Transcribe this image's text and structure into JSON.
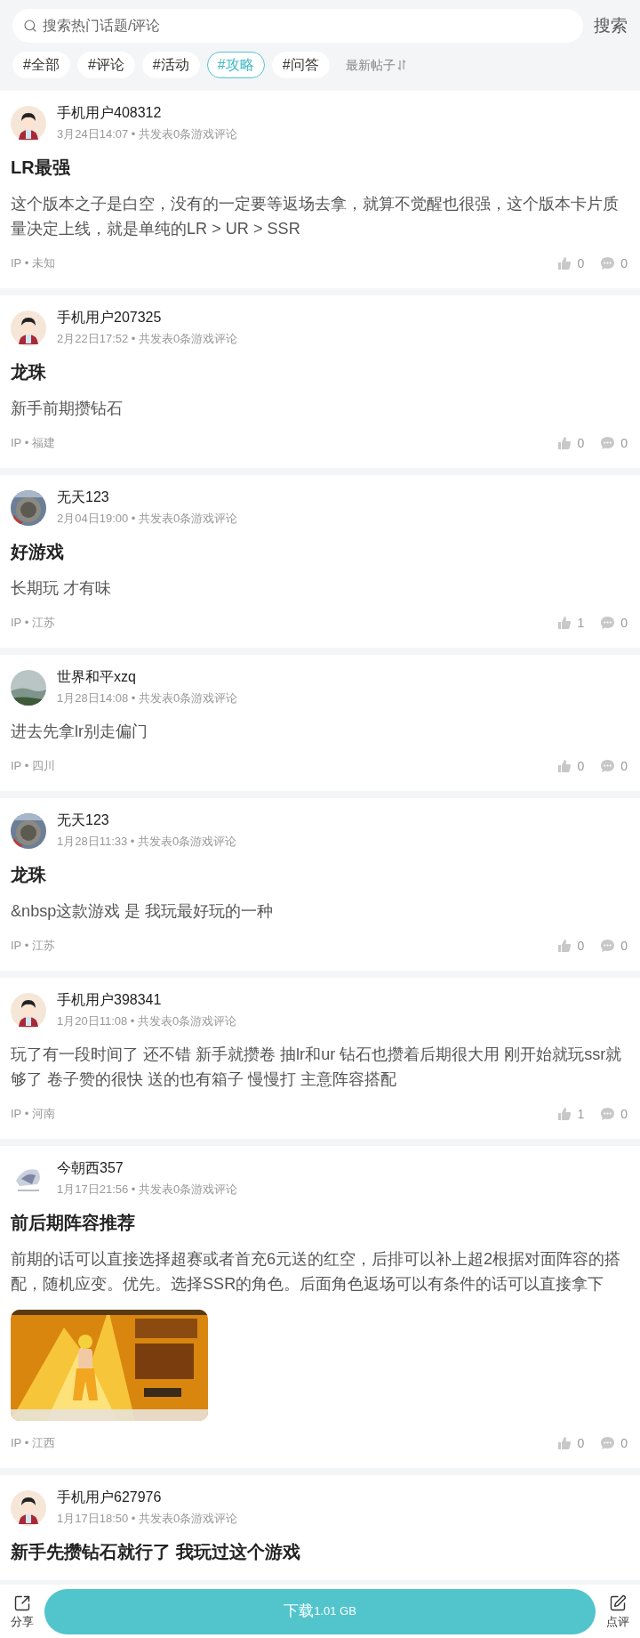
{
  "search": {
    "placeholder": "搜索热门话题/评论",
    "button": "搜索"
  },
  "tags": [
    {
      "label": "#全部",
      "selected": false
    },
    {
      "label": "#评论",
      "selected": false
    },
    {
      "label": "#活动",
      "selected": false
    },
    {
      "label": "#攻略",
      "selected": true
    },
    {
      "label": "#问答",
      "selected": false
    }
  ],
  "sort": {
    "label": "最新帖子"
  },
  "posts": [
    {
      "user": "手机用户408312",
      "avatar": {
        "kind": "cartoon"
      },
      "meta": "3月24日14:07 • 共发表0条游戏评论",
      "title": "LR最强",
      "body": "这个版本之子是白空，没有的一定要等返场去拿，就算不觉醒也很强，这个版本卡片质量决定上线，就是单纯的LR > UR > SSR",
      "ip": "IP • 未知",
      "likes": "0",
      "comments": "0"
    },
    {
      "user": "手机用户207325",
      "avatar": {
        "kind": "cartoon"
      },
      "meta": "2月22日17:52 • 共发表0条游戏评论",
      "title": "龙珠",
      "body": "新手前期攒钻石",
      "ip": "IP • 福建",
      "likes": "0",
      "comments": "0"
    },
    {
      "user": "无天123",
      "meta": "2月04日19:00 • 共发表0条游戏评论",
      "title": "好游戏",
      "body": "长期玩 才有味",
      "ip": "IP • 江苏",
      "likes": "1",
      "comments": "0"
    },
    {
      "user": "世界和平xzq",
      "avatar": {
        "kind": "landscape"
      },
      "meta": "1月28日14:08 • 共发表0条游戏评论",
      "body": "进去先拿lr别走偏门",
      "ip": "IP • 四川",
      "likes": "0",
      "comments": "0"
    },
    {
      "user": "无天123",
      "meta": "1月28日11:33 • 共发表0条游戏评论",
      "title": "龙珠",
      "body": "&nbsp这款游戏 是 我玩最好玩的一种",
      "ip": "IP • 江苏",
      "likes": "0",
      "comments": "0"
    },
    {
      "user": "手机用户398341",
      "avatar": {
        "kind": "cartoon"
      },
      "meta": "1月20日11:08 • 共发表0条游戏评论",
      "body": "玩了有一段时间了 还不错 新手就攒卷 抽lr和ur 钻石也攒着后期很大用 刚开始就玩ssr就够了 卷子赞的很快 送的也有箱子 慢慢打 主意阵容搭配",
      "ip": "IP • 河南",
      "likes": "1",
      "comments": "0"
    },
    {
      "user": "今朝西357",
      "avatar": {
        "kind": "sketch"
      },
      "meta": "1月17日21:56 • 共发表0条游戏评论",
      "title": "前后期阵容推荐",
      "body": "前期的话可以直接选择超赛或者首充6元送的红空，后排可以补上超2根据对面阵容的搭配，随机应变。优先。选择SSR的角色。后面角色返场可以有条件的话可以直接拿下",
      "ip": "IP • 江西",
      "likes": "0",
      "comments": "0"
    },
    {
      "user": "手机用户627976",
      "avatar": {
        "kind": "cartoon"
      },
      "meta": "1月17日18:50 • 共发表0条游戏评论",
      "title": "新手先攒钻石就行了 我玩过这个游戏"
    }
  ],
  "bottom_bar": {
    "share": "分享",
    "download": "下载",
    "size": "1.01 GB",
    "review": "点评"
  }
}
